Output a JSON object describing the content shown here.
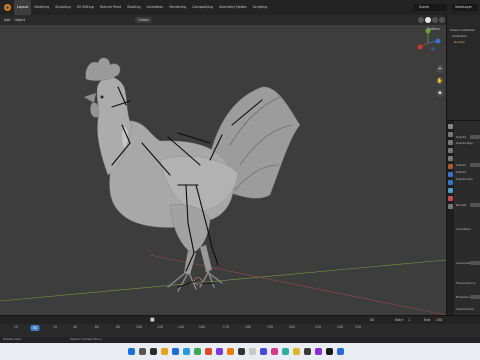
{
  "topbar": {
    "menus": [
      "Layout",
      "Modeling",
      "Sculpting",
      "UV Editing",
      "Texture Paint",
      "Shading",
      "Animation",
      "Rendering",
      "Compositing",
      "Geometry Nodes",
      "Scripting"
    ],
    "active_menu": "Layout",
    "scene": "Scene",
    "view_layer": "ViewLayer"
  },
  "viewport_header": {
    "add_label": "Add",
    "object_label": "Object",
    "orientation": "Global",
    "options_label": "Options"
  },
  "outliner": {
    "rows": [
      "Scene Collection",
      "Collection",
      "Rooster"
    ]
  },
  "properties": {
    "labels": [
      "Subdiv",
      "Subdiv Ray",
      "Subdiv",
      "Subdiv",
      "Subdiv Ren",
      "Render",
      "Animated",
      "Clearcoat",
      "Translucency",
      "Emission",
      "Clearcoat N"
    ]
  },
  "timeline": {
    "current_frame": "50",
    "ticks": [
      "10",
      "20",
      "40",
      "60",
      "80",
      "100",
      "120",
      "140",
      "160",
      "170",
      "180",
      "190",
      "200",
      "220",
      "240",
      "250"
    ],
    "start_label": "Start",
    "start_value": "1",
    "end_label": "End",
    "end_value": "250"
  },
  "statusbar": {
    "left": "Rotate View",
    "center": "Object Context Menu"
  },
  "colors": {
    "accent": "#3f82c6",
    "blender_orange": "#e87d0d"
  }
}
